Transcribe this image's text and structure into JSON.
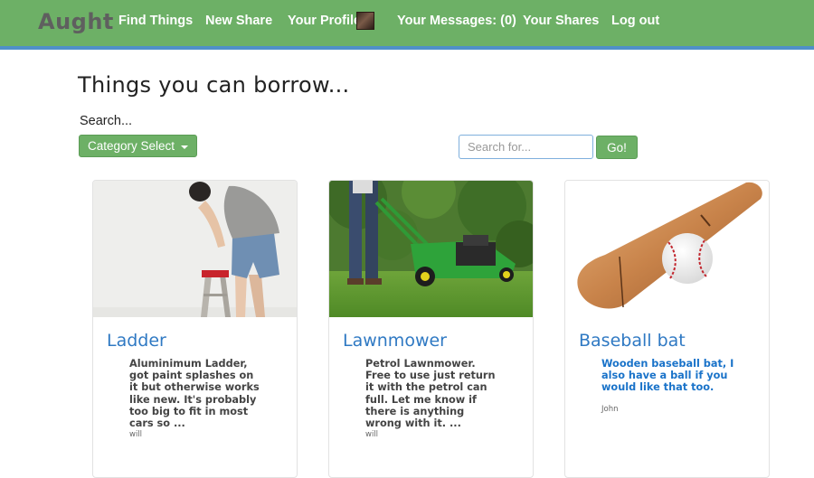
{
  "navbar": {
    "brand": "Aught",
    "items": [
      {
        "label": "Find Things"
      },
      {
        "label": "New Share"
      },
      {
        "label": "Your Profile:"
      },
      {
        "label": "Your Messages: (0)"
      },
      {
        "label": "Your Shares"
      },
      {
        "label": "Log out"
      }
    ]
  },
  "page": {
    "title": "Things you can borrow...",
    "search_label": "Search...",
    "category_button": "Category Select",
    "search_placeholder": "Search for...",
    "go_button": "Go!"
  },
  "cards": [
    {
      "title": "Ladder",
      "description": "Aluminimum Ladder, got paint splashes on it but otherwise works like new. It's probably too big to fit in most cars so ...",
      "owner": "will"
    },
    {
      "title": "Lawnmower",
      "description": "Petrol Lawnmower. Free to use just return it with the petrol can full. Let me know if there is anything wrong with it. ...",
      "owner": "will"
    },
    {
      "title": "Baseball bat",
      "description": "Wooden baseball bat, I also have a ball if you would like that too.",
      "owner": "John"
    }
  ],
  "colors": {
    "navbar_green": "#6db066",
    "navbar_border_blue": "#4f90c8",
    "link_blue": "#2f79c3"
  },
  "icons": [
    "profile-avatar-icon",
    "caret-down-icon"
  ]
}
